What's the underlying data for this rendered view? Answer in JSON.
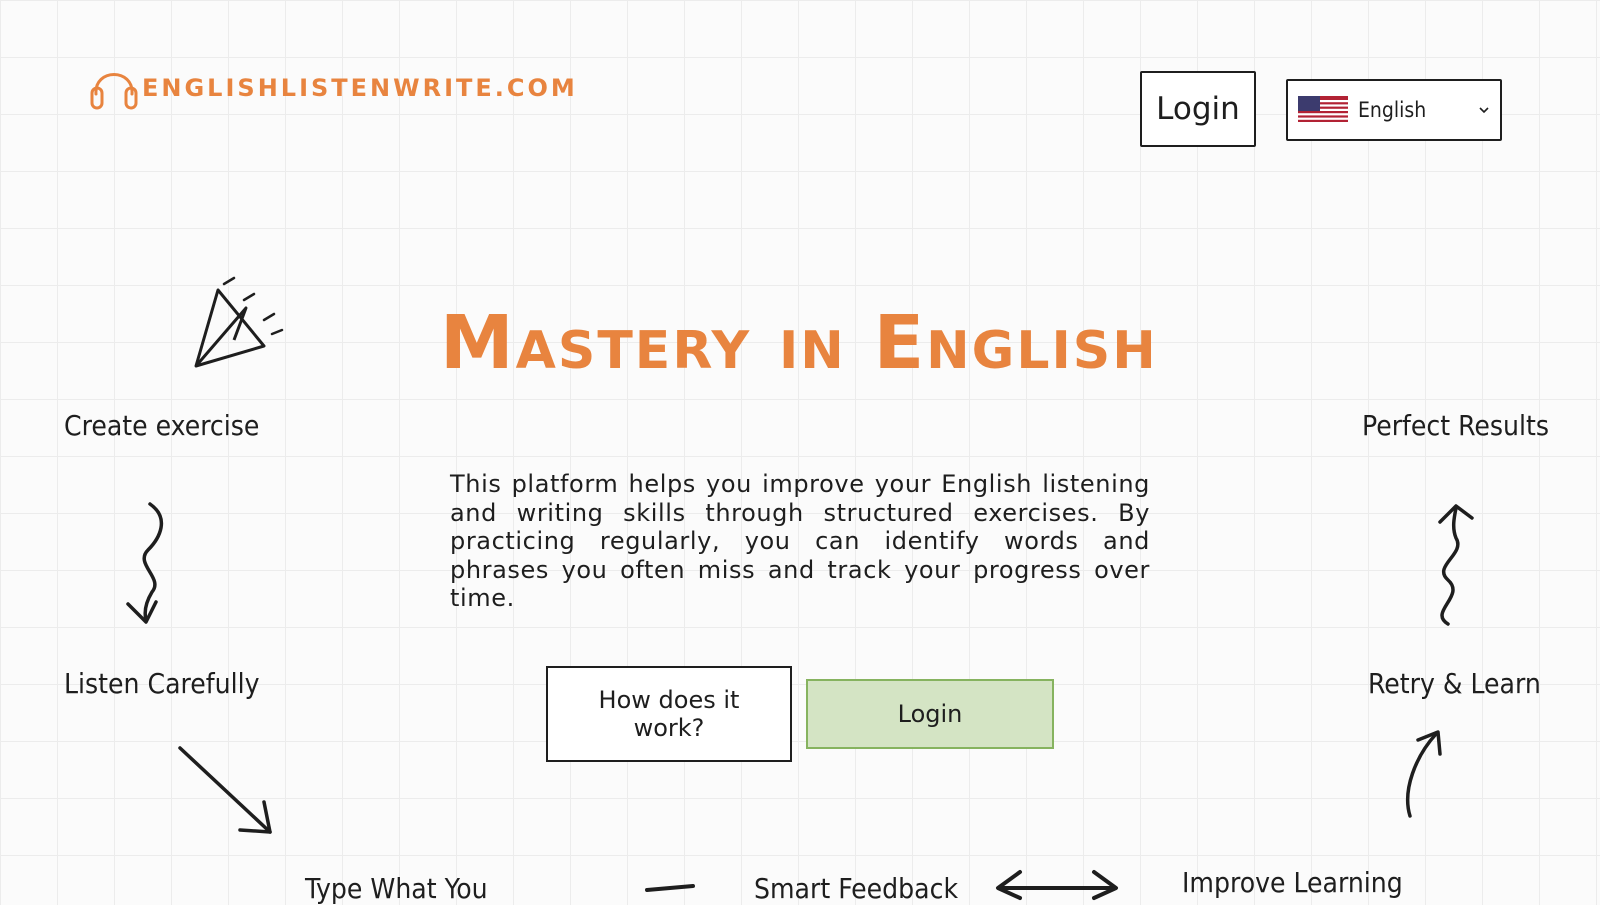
{
  "header": {
    "logo_text": "ENGLISHLISTENWRITE.COM",
    "login_label": "Login",
    "language": {
      "selected": "English",
      "flag": "us-flag-icon"
    }
  },
  "hero": {
    "title": "Mastery in English",
    "description": "This platform helps you improve your English listening and writing skills through structured exercises. By practicing regularly, you can identify words and phrases you often miss and track your progress over time.",
    "how_button": "How does it work?",
    "login_button": "Login"
  },
  "steps": {
    "create": "Create exercise",
    "listen": "Listen Carefully",
    "type": "Type What You",
    "feedback": "Smart Feedback",
    "improve": "Improve Learning",
    "retry": "Retry & Learn",
    "perfect": "Perfect Results"
  },
  "colors": {
    "accent": "#e8843f",
    "login_bg": "#d4e4c4",
    "login_border": "#86b35f",
    "ink": "#1e1e1e"
  }
}
